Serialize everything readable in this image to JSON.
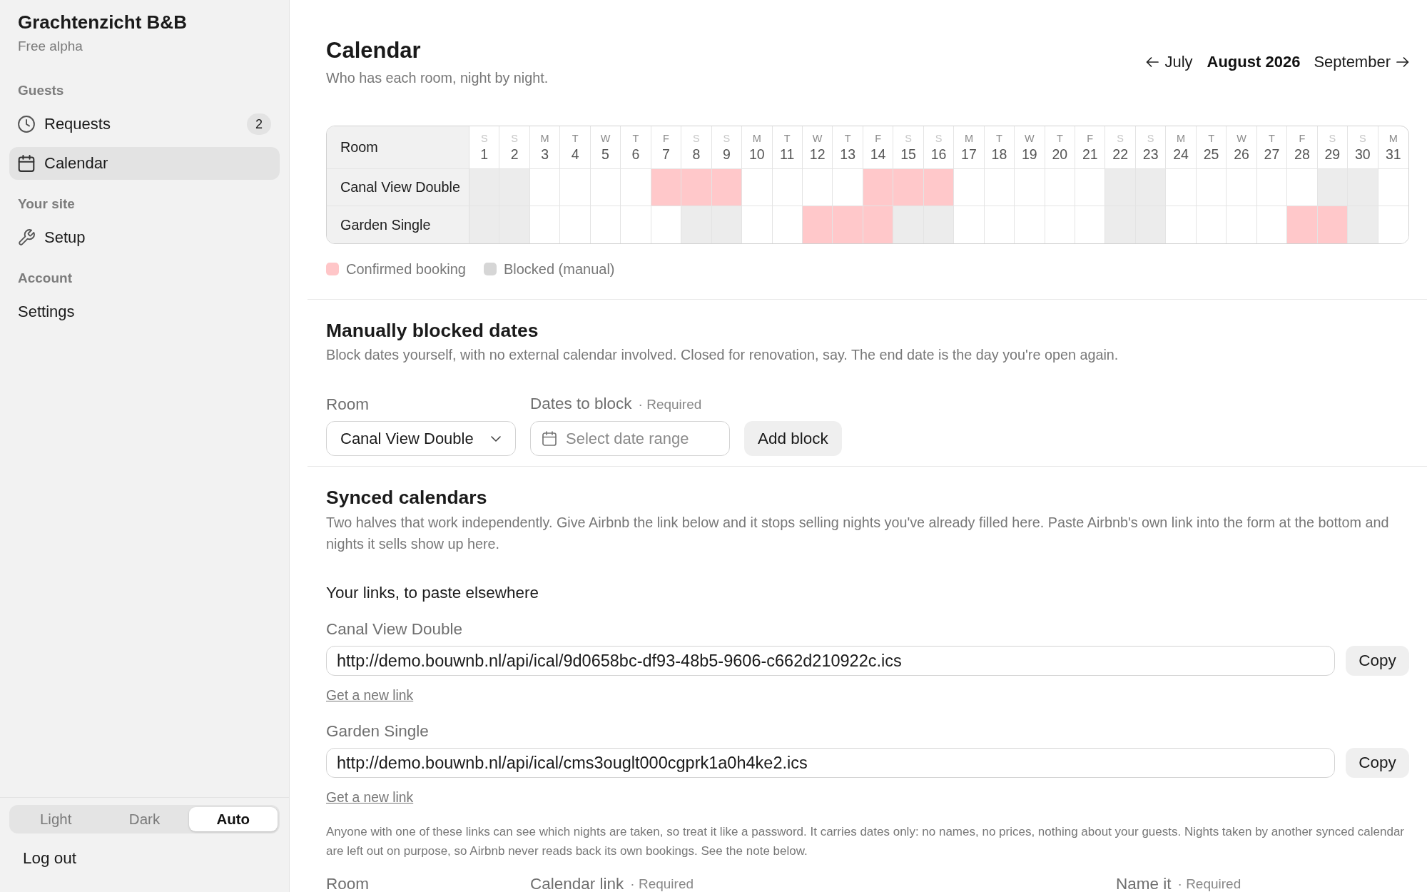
{
  "sidebar": {
    "brand": "Grachtenzicht B&B",
    "plan": "Free alpha",
    "sections": [
      {
        "heading": "Guests",
        "items": [
          {
            "label": "Requests",
            "badge": "2",
            "selected": false
          },
          {
            "label": "Calendar",
            "selected": true
          }
        ]
      },
      {
        "heading": "Your site",
        "items": [
          {
            "label": "Setup",
            "selected": false
          }
        ]
      },
      {
        "heading": "Account",
        "items": [
          {
            "label": "Settings",
            "selected": false
          }
        ]
      }
    ],
    "theme_switch": [
      {
        "label": "Light",
        "selected": false
      },
      {
        "label": "Dark",
        "selected": false
      },
      {
        "label": "Auto",
        "selected": true
      }
    ],
    "logout": "Log out"
  },
  "header": {
    "title": "Calendar",
    "subtitle": "Who has each room, night by night.",
    "month_nav": {
      "previous": "July",
      "current": "August 2026",
      "next": "September"
    }
  },
  "calendar": {
    "room_column": "Room",
    "days": [
      {
        "weekday": "S",
        "day": "1",
        "weekend": true
      },
      {
        "weekday": "S",
        "day": "2",
        "weekend": true
      },
      {
        "weekday": "M",
        "day": "3",
        "weekend": false
      },
      {
        "weekday": "T",
        "day": "4",
        "weekend": false
      },
      {
        "weekday": "W",
        "day": "5",
        "weekend": false
      },
      {
        "weekday": "T",
        "day": "6",
        "weekend": false
      },
      {
        "weekday": "F",
        "day": "7",
        "weekend": false
      },
      {
        "weekday": "S",
        "day": "8",
        "weekend": true
      },
      {
        "weekday": "S",
        "day": "9",
        "weekend": true
      },
      {
        "weekday": "M",
        "day": "10",
        "weekend": false
      },
      {
        "weekday": "T",
        "day": "11",
        "weekend": false
      },
      {
        "weekday": "W",
        "day": "12",
        "weekend": false
      },
      {
        "weekday": "T",
        "day": "13",
        "weekend": false
      },
      {
        "weekday": "F",
        "day": "14",
        "weekend": false
      },
      {
        "weekday": "S",
        "day": "15",
        "weekend": true
      },
      {
        "weekday": "S",
        "day": "16",
        "weekend": true
      },
      {
        "weekday": "M",
        "day": "17",
        "weekend": false
      },
      {
        "weekday": "T",
        "day": "18",
        "weekend": false
      },
      {
        "weekday": "W",
        "day": "19",
        "weekend": false
      },
      {
        "weekday": "T",
        "day": "20",
        "weekend": false
      },
      {
        "weekday": "F",
        "day": "21",
        "weekend": false
      },
      {
        "weekday": "S",
        "day": "22",
        "weekend": true
      },
      {
        "weekday": "S",
        "day": "23",
        "weekend": true
      },
      {
        "weekday": "M",
        "day": "24",
        "weekend": false
      },
      {
        "weekday": "T",
        "day": "25",
        "weekend": false
      },
      {
        "weekday": "W",
        "day": "26",
        "weekend": false
      },
      {
        "weekday": "T",
        "day": "27",
        "weekend": false
      },
      {
        "weekday": "F",
        "day": "28",
        "weekend": false
      },
      {
        "weekday": "S",
        "day": "29",
        "weekend": true
      },
      {
        "weekday": "S",
        "day": "30",
        "weekend": true
      },
      {
        "weekday": "M",
        "day": "31",
        "weekend": false
      }
    ],
    "rows": [
      {
        "room": "Canal View Double",
        "nights": [
          {
            "kind": "blocked"
          },
          {
            "kind": "blocked"
          },
          {
            "kind": "free"
          },
          {
            "kind": "free"
          },
          {
            "kind": "free"
          },
          {
            "kind": "free"
          },
          {
            "kind": "booked"
          },
          {
            "kind": "booked"
          },
          {
            "kind": "booked"
          },
          {
            "kind": "free"
          },
          {
            "kind": "free"
          },
          {
            "kind": "free"
          },
          {
            "kind": "free"
          },
          {
            "kind": "booked"
          },
          {
            "kind": "booked"
          },
          {
            "kind": "booked"
          },
          {
            "kind": "free"
          },
          {
            "kind": "free"
          },
          {
            "kind": "free"
          },
          {
            "kind": "free"
          },
          {
            "kind": "free"
          },
          {
            "kind": "blocked"
          },
          {
            "kind": "blocked"
          },
          {
            "kind": "free"
          },
          {
            "kind": "free"
          },
          {
            "kind": "free"
          },
          {
            "kind": "free"
          },
          {
            "kind": "free"
          },
          {
            "kind": "blocked"
          },
          {
            "kind": "blocked"
          },
          {
            "kind": "free"
          }
        ]
      },
      {
        "room": "Garden Single",
        "nights": [
          {
            "kind": "blocked"
          },
          {
            "kind": "blocked"
          },
          {
            "kind": "free"
          },
          {
            "kind": "free"
          },
          {
            "kind": "free"
          },
          {
            "kind": "free"
          },
          {
            "kind": "free"
          },
          {
            "kind": "blocked"
          },
          {
            "kind": "blocked"
          },
          {
            "kind": "free"
          },
          {
            "kind": "free"
          },
          {
            "kind": "booked"
          },
          {
            "kind": "booked"
          },
          {
            "kind": "booked"
          },
          {
            "kind": "blocked"
          },
          {
            "kind": "blocked"
          },
          {
            "kind": "free"
          },
          {
            "kind": "free"
          },
          {
            "kind": "free"
          },
          {
            "kind": "free"
          },
          {
            "kind": "free"
          },
          {
            "kind": "blocked"
          },
          {
            "kind": "blocked"
          },
          {
            "kind": "free"
          },
          {
            "kind": "free"
          },
          {
            "kind": "free"
          },
          {
            "kind": "free"
          },
          {
            "kind": "booked"
          },
          {
            "kind": "booked"
          },
          {
            "kind": "blocked"
          },
          {
            "kind": "free"
          }
        ]
      }
    ],
    "legend": [
      {
        "label": "Confirmed booking",
        "color": "#ffc6c8"
      },
      {
        "label": "Blocked (manual)",
        "color": "#d6d6d6"
      }
    ]
  },
  "blocked_dates": {
    "title": "Manually blocked dates",
    "description": "Block dates yourself, with no external calendar involved. Closed for renovation, say. The end date is the day you're open again.",
    "form": {
      "room": {
        "label": "Room",
        "value": "Canal View Double"
      },
      "dates": {
        "label": "Dates to block",
        "required": "· Required",
        "placeholder": "Select date range"
      },
      "button": "Add block"
    }
  },
  "synced": {
    "title": "Synced calendars",
    "description": "Two halves that work independently. Give Airbnb the link below and it stops selling nights you've already filled here. Paste Airbnb's own link into the form at the bottom and nights it sells show up here.",
    "links_heading": "Your links, to paste elsewhere",
    "links": [
      {
        "room": "Canal View Double",
        "url": "http://demo.bouwnb.nl/api/ical/9d0658bc-df93-48b5-9606-c662d210922c.ics",
        "copy": "Copy",
        "renew": "Get a new link"
      },
      {
        "room": "Garden Single",
        "url": "http://demo.bouwnb.nl/api/ical/cms3ouglt000cgprk1a0h4ke2.ics",
        "copy": "Copy",
        "renew": "Get a new link"
      }
    ],
    "note": "Anyone with one of these links can see which nights are taken, so treat it like a password. It carries dates only: no names, no prices, nothing about your guests. Nights taken by another synced calendar are left out on purpose, so Airbnb never reads back its own bookings. See the note below.",
    "import_form": {
      "room": {
        "label": "Room"
      },
      "link": {
        "label": "Calendar link",
        "required": "· Required"
      },
      "name": {
        "label": "Name it",
        "required": "· Required"
      }
    }
  }
}
